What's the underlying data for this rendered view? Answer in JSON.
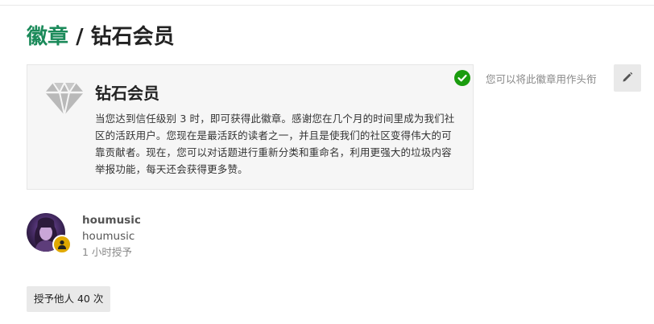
{
  "breadcrumb": {
    "parent_label": "徽章",
    "separator": " / ",
    "current_label": "钻石会员"
  },
  "badge": {
    "name": "钻石会员",
    "description": "当您达到信任级别 3 时，即可获得此徽章。感谢您在几个月的时间里成为我们社区的活跃用户。您现在是最活跃的读者之一，并且是使我们的社区变得伟大的可靠贡献者。现在，您可以对话题进行重新分类和重命名，利用更强大的垃圾内容举报功能，每天还会获得更多赞。",
    "icon": "diamond-icon",
    "granted_icon": "check-circle-icon",
    "colors": {
      "icon": "#b9b9b9",
      "check": "#1a9c0e",
      "link": "#1b8a5a"
    }
  },
  "title_hint": "您可以将此徽章用作头衔",
  "edit_icon": "pencil-icon",
  "user": {
    "username": "houmusic",
    "display_name": "houmusic",
    "granted_time": "1 小时授予",
    "flair_icon": "user-icon",
    "flair_color": "#e0a800"
  },
  "granted_count_label": "授予他人 40 次"
}
